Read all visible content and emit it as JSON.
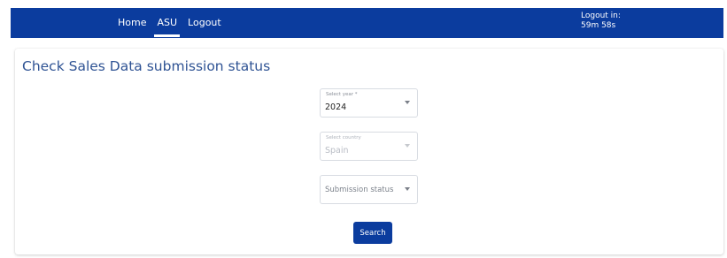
{
  "nav": {
    "items": [
      {
        "label": "Home",
        "active": false
      },
      {
        "label": "ASU",
        "active": true
      },
      {
        "label": "Logout",
        "active": false
      }
    ]
  },
  "session": {
    "label": "Logout in:",
    "countdown": "59m 58s"
  },
  "page": {
    "title": "Check Sales Data submission status"
  },
  "form": {
    "year": {
      "label": "Select year *",
      "value": "2024",
      "icon": "chevron-down-icon"
    },
    "country": {
      "label": "Select country",
      "value": "Spain",
      "disabled": true,
      "icon": "chevron-down-icon"
    },
    "status": {
      "placeholder": "Submission status",
      "icon": "chevron-down-icon"
    },
    "search_label": "Search"
  },
  "colors": {
    "primary": "#0b3c9e",
    "title": "#2f5394"
  }
}
